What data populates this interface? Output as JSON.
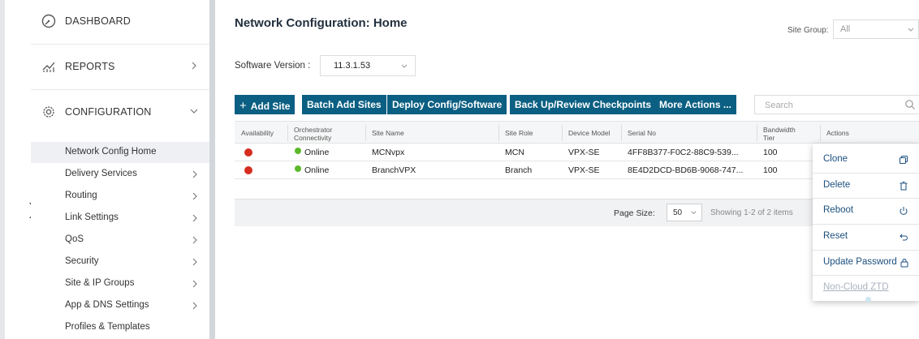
{
  "sidebar": {
    "main": [
      {
        "label": "DASHBOARD",
        "icon": "dashboard-gauge-icon"
      },
      {
        "label": "REPORTS",
        "icon": "reports-chart-icon"
      },
      {
        "label": "CONFIGURATION",
        "icon": "configuration-gear-icon"
      }
    ],
    "sub": [
      {
        "label": "Network Config Home",
        "active": true
      },
      {
        "label": "Delivery Services"
      },
      {
        "label": "Routing"
      },
      {
        "label": "Link Settings"
      },
      {
        "label": "QoS"
      },
      {
        "label": "Security"
      },
      {
        "label": "Site & IP Groups"
      },
      {
        "label": "App & DNS Settings"
      },
      {
        "label": "Profiles & Templates"
      }
    ]
  },
  "header": {
    "title": "Network Configuration: Home",
    "site_group_label": "Site Group:",
    "site_group_value": "All"
  },
  "software": {
    "label": "Software Version :",
    "value": "11.3.1.53"
  },
  "toolbar": {
    "add_site": "Add Site",
    "add_icon": "+",
    "batch_add": "Batch Add Sites",
    "deploy": "Deploy Config/Software",
    "backup": "Back Up/Review Checkpoints",
    "more": "More Actions ..."
  },
  "search": {
    "placeholder": "Search"
  },
  "table": {
    "columns": [
      "Availability",
      "Orchestrator Connectivity",
      "Site Name",
      "Site Role",
      "Device Model",
      "Serial No",
      "Bandwidth Tier",
      "Actions"
    ],
    "rows": [
      {
        "availability": "red",
        "connectivity": "Online",
        "site_name": "MCNvpx",
        "site_role": "MCN",
        "device_model": "VPX-SE",
        "serial": "4FF8B377-F0C2-88C9-539...",
        "bandwidth": "100"
      },
      {
        "availability": "red",
        "connectivity": "Online",
        "site_name": "BranchVPX",
        "site_role": "Branch",
        "device_model": "VPX-SE",
        "serial": "8E4D2DCD-BD6B-9068-747...",
        "bandwidth": "100"
      }
    ]
  },
  "pager": {
    "page_size_label": "Page Size:",
    "page_size": "50",
    "showing": "Showing 1-2 of 2 items"
  },
  "actions_menu": {
    "items": [
      {
        "label": "Clone",
        "icon": "clone-copy-icon"
      },
      {
        "label": "Delete",
        "icon": "trash-icon"
      },
      {
        "label": "Reboot",
        "icon": "power-icon"
      },
      {
        "label": "Reset",
        "icon": "undo-icon"
      },
      {
        "label": "Update Password",
        "icon": "lock-icon"
      },
      {
        "label": "Non-Cloud ZTD",
        "disabled": true
      }
    ]
  },
  "colors": {
    "primary_button": "#0b5f82",
    "status_offline": "#d62d20",
    "status_online": "#5cb829",
    "menu_text": "#1b4f80"
  }
}
